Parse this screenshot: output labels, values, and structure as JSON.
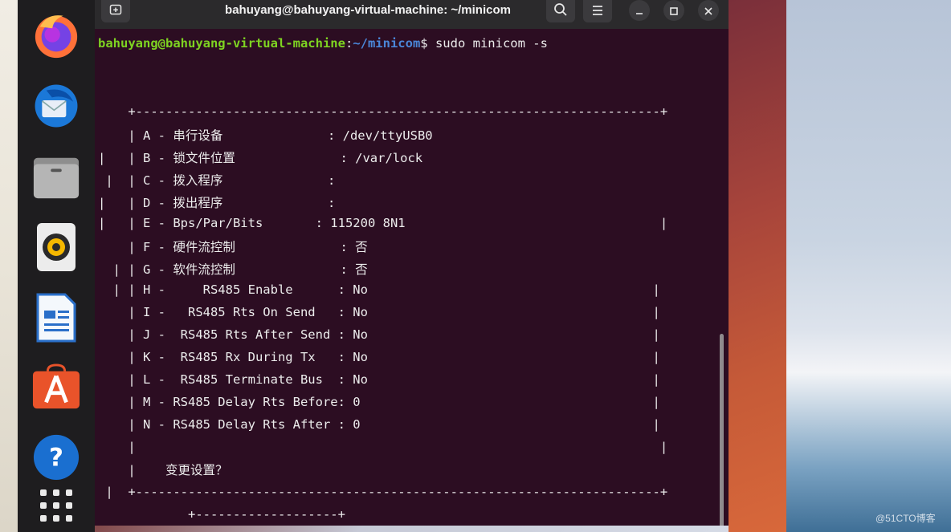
{
  "window": {
    "title": "bahuyang@bahuyang-virtual-machine: ~/minicom"
  },
  "icons": {
    "new_tab": "new-tab-icon",
    "search": "search-icon",
    "menu": "hamburger-menu-icon",
    "minimize": "minimize-icon",
    "maximize": "maximize-icon",
    "close": "close-icon"
  },
  "dock": {
    "apps": [
      "firefox",
      "thunderbird",
      "files",
      "rhythmbox",
      "libreoffice-writer",
      "app-center",
      "help",
      "show-applications"
    ]
  },
  "prompt": {
    "user_host": "bahuyang@bahuyang-virtual-machine",
    "colon": ":",
    "path": "~/minicom",
    "symbol": "$",
    "command": " sudo minicom -s"
  },
  "menu": {
    "top_border": "    +----------------------------------------------------------------------+",
    "rows": [
      "    | A - 串行设备              : /dev/ttyUSB0",
      "|   | B - 锁文件位置              : /var/lock",
      " |  | C - 拨入程序              :",
      "|   | D - 拨出程序              :",
      "|   | E - Bps/Par/Bits       : 115200 8N1                                  |",
      "    | F - 硬件流控制              : 否",
      "  | | G - 软件流控制              : 否",
      "  | | H -     RS485 Enable      : No                                      |",
      "    | I -   RS485 Rts On Send   : No                                      |",
      "    | J -  RS485 Rts After Send : No                                      |",
      "    | K -  RS485 Rx During Tx   : No                                      |",
      "    | L -  RS485 Terminate Bus  : No                                      |",
      "    | M - RS485 Delay Rts Before: 0                                       |",
      "    | N - RS485 Delay Rts After : 0                                       |",
      "    |                                                                      |",
      "    |    变更设置？"
    ],
    "bottom_border": " |  +----------------------------------------------------------------------+",
    "sub_box": "            +-------------------+"
  },
  "watermark": "@51CTO博客"
}
